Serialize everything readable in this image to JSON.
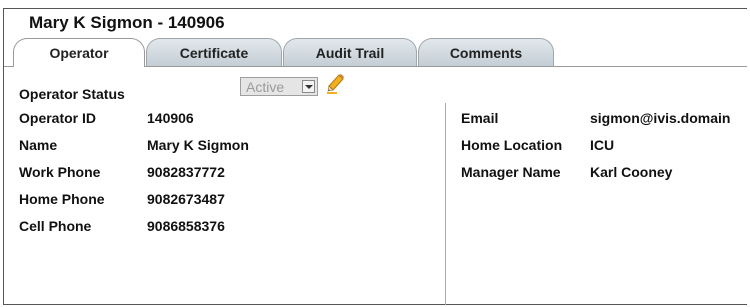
{
  "header": {
    "title": "Mary K Sigmon - 140906"
  },
  "tabs": [
    {
      "label": "Operator",
      "active": true
    },
    {
      "label": "Certificate",
      "active": false
    },
    {
      "label": "Audit Trail",
      "active": false
    },
    {
      "label": "Comments",
      "active": false
    }
  ],
  "status": {
    "label": "Operator Status",
    "selected": "Active",
    "edit_icon": "pencil-icon"
  },
  "left_fields": [
    {
      "label": "Operator ID",
      "value": "140906"
    },
    {
      "label": "Name",
      "value": "Mary K Sigmon"
    },
    {
      "label": "Work Phone",
      "value": "9082837772"
    },
    {
      "label": "Home Phone",
      "value": "9082673487"
    },
    {
      "label": "Cell Phone",
      "value": "9086858376"
    }
  ],
  "right_fields": [
    {
      "label": "Email",
      "value": "sigmon@ivis.domain"
    },
    {
      "label": "Home Location",
      "value": "ICU"
    },
    {
      "label": "Manager Name",
      "value": "Karl Cooney"
    }
  ],
  "colors": {
    "tab_inactive": "#cdd6dc",
    "tab_border": "#9fa7ad",
    "pencil": "#f2b01e"
  }
}
